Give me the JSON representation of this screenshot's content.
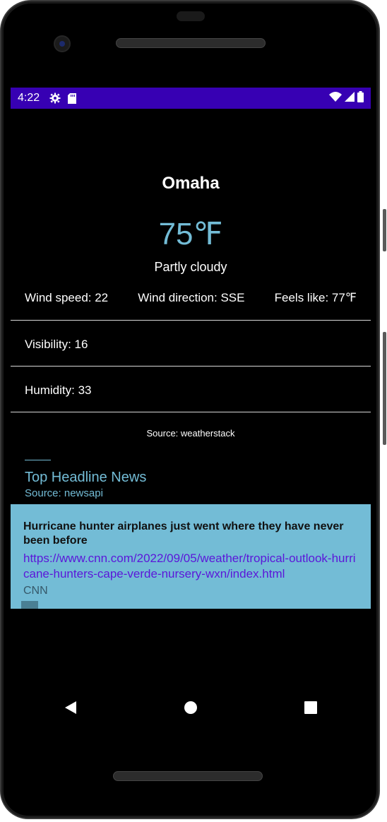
{
  "status_bar": {
    "time": "4:22",
    "left_icons": [
      "gear-icon",
      "sd-card-icon"
    ],
    "right_icons": [
      "wifi-icon",
      "signal-icon",
      "battery-icon"
    ],
    "bg_color": "#3700b3"
  },
  "weather": {
    "city": "Omaha",
    "temperature": "75℉",
    "condition": "Partly cloudy",
    "wind_speed": "Wind speed: 22",
    "wind_direction": "Wind direction: SSE",
    "feels_like": "Feels like: 77℉",
    "visibility": "Visibility: 16",
    "humidity": "Humidity: 33",
    "source": "Source: weatherstack"
  },
  "news": {
    "heading": "Top Headline News",
    "source": "Source: newsapi",
    "articles": [
      {
        "headline": "Hurricane hunter airplanes just went where they have never been before",
        "url": "https://www.cnn.com/2022/09/05/weather/tropical-outlook-hurricane-hunters-cape-verde-nursery-wxn/index.html",
        "source": "CNN"
      }
    ]
  },
  "nav_bar": {
    "buttons": [
      "back-icon",
      "home-icon",
      "recents-icon"
    ]
  },
  "colors": {
    "accent": "#73bcd6",
    "link": "#5b16d9",
    "background": "#000000"
  }
}
